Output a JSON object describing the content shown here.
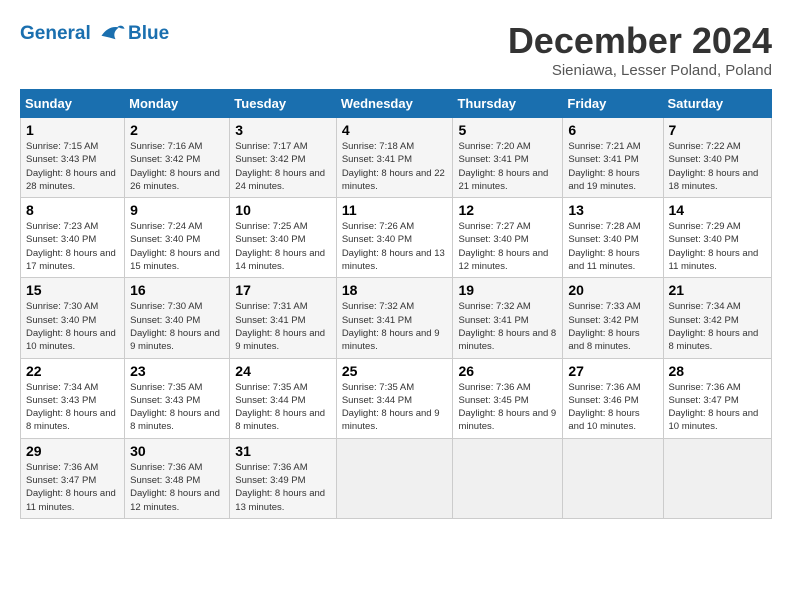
{
  "logo": {
    "line1": "General",
    "line2": "Blue"
  },
  "title": "December 2024",
  "subtitle": "Sieniawa, Lesser Poland, Poland",
  "days_header": [
    "Sunday",
    "Monday",
    "Tuesday",
    "Wednesday",
    "Thursday",
    "Friday",
    "Saturday"
  ],
  "weeks": [
    [
      {
        "day": "1",
        "sunrise": "Sunrise: 7:15 AM",
        "sunset": "Sunset: 3:43 PM",
        "daylight": "Daylight: 8 hours and 28 minutes."
      },
      {
        "day": "2",
        "sunrise": "Sunrise: 7:16 AM",
        "sunset": "Sunset: 3:42 PM",
        "daylight": "Daylight: 8 hours and 26 minutes."
      },
      {
        "day": "3",
        "sunrise": "Sunrise: 7:17 AM",
        "sunset": "Sunset: 3:42 PM",
        "daylight": "Daylight: 8 hours and 24 minutes."
      },
      {
        "day": "4",
        "sunrise": "Sunrise: 7:18 AM",
        "sunset": "Sunset: 3:41 PM",
        "daylight": "Daylight: 8 hours and 22 minutes."
      },
      {
        "day": "5",
        "sunrise": "Sunrise: 7:20 AM",
        "sunset": "Sunset: 3:41 PM",
        "daylight": "Daylight: 8 hours and 21 minutes."
      },
      {
        "day": "6",
        "sunrise": "Sunrise: 7:21 AM",
        "sunset": "Sunset: 3:41 PM",
        "daylight": "Daylight: 8 hours and 19 minutes."
      },
      {
        "day": "7",
        "sunrise": "Sunrise: 7:22 AM",
        "sunset": "Sunset: 3:40 PM",
        "daylight": "Daylight: 8 hours and 18 minutes."
      }
    ],
    [
      {
        "day": "8",
        "sunrise": "Sunrise: 7:23 AM",
        "sunset": "Sunset: 3:40 PM",
        "daylight": "Daylight: 8 hours and 17 minutes."
      },
      {
        "day": "9",
        "sunrise": "Sunrise: 7:24 AM",
        "sunset": "Sunset: 3:40 PM",
        "daylight": "Daylight: 8 hours and 15 minutes."
      },
      {
        "day": "10",
        "sunrise": "Sunrise: 7:25 AM",
        "sunset": "Sunset: 3:40 PM",
        "daylight": "Daylight: 8 hours and 14 minutes."
      },
      {
        "day": "11",
        "sunrise": "Sunrise: 7:26 AM",
        "sunset": "Sunset: 3:40 PM",
        "daylight": "Daylight: 8 hours and 13 minutes."
      },
      {
        "day": "12",
        "sunrise": "Sunrise: 7:27 AM",
        "sunset": "Sunset: 3:40 PM",
        "daylight": "Daylight: 8 hours and 12 minutes."
      },
      {
        "day": "13",
        "sunrise": "Sunrise: 7:28 AM",
        "sunset": "Sunset: 3:40 PM",
        "daylight": "Daylight: 8 hours and 11 minutes."
      },
      {
        "day": "14",
        "sunrise": "Sunrise: 7:29 AM",
        "sunset": "Sunset: 3:40 PM",
        "daylight": "Daylight: 8 hours and 11 minutes."
      }
    ],
    [
      {
        "day": "15",
        "sunrise": "Sunrise: 7:30 AM",
        "sunset": "Sunset: 3:40 PM",
        "daylight": "Daylight: 8 hours and 10 minutes."
      },
      {
        "day": "16",
        "sunrise": "Sunrise: 7:30 AM",
        "sunset": "Sunset: 3:40 PM",
        "daylight": "Daylight: 8 hours and 9 minutes."
      },
      {
        "day": "17",
        "sunrise": "Sunrise: 7:31 AM",
        "sunset": "Sunset: 3:41 PM",
        "daylight": "Daylight: 8 hours and 9 minutes."
      },
      {
        "day": "18",
        "sunrise": "Sunrise: 7:32 AM",
        "sunset": "Sunset: 3:41 PM",
        "daylight": "Daylight: 8 hours and 9 minutes."
      },
      {
        "day": "19",
        "sunrise": "Sunrise: 7:32 AM",
        "sunset": "Sunset: 3:41 PM",
        "daylight": "Daylight: 8 hours and 8 minutes."
      },
      {
        "day": "20",
        "sunrise": "Sunrise: 7:33 AM",
        "sunset": "Sunset: 3:42 PM",
        "daylight": "Daylight: 8 hours and 8 minutes."
      },
      {
        "day": "21",
        "sunrise": "Sunrise: 7:34 AM",
        "sunset": "Sunset: 3:42 PM",
        "daylight": "Daylight: 8 hours and 8 minutes."
      }
    ],
    [
      {
        "day": "22",
        "sunrise": "Sunrise: 7:34 AM",
        "sunset": "Sunset: 3:43 PM",
        "daylight": "Daylight: 8 hours and 8 minutes."
      },
      {
        "day": "23",
        "sunrise": "Sunrise: 7:35 AM",
        "sunset": "Sunset: 3:43 PM",
        "daylight": "Daylight: 8 hours and 8 minutes."
      },
      {
        "day": "24",
        "sunrise": "Sunrise: 7:35 AM",
        "sunset": "Sunset: 3:44 PM",
        "daylight": "Daylight: 8 hours and 8 minutes."
      },
      {
        "day": "25",
        "sunrise": "Sunrise: 7:35 AM",
        "sunset": "Sunset: 3:44 PM",
        "daylight": "Daylight: 8 hours and 9 minutes."
      },
      {
        "day": "26",
        "sunrise": "Sunrise: 7:36 AM",
        "sunset": "Sunset: 3:45 PM",
        "daylight": "Daylight: 8 hours and 9 minutes."
      },
      {
        "day": "27",
        "sunrise": "Sunrise: 7:36 AM",
        "sunset": "Sunset: 3:46 PM",
        "daylight": "Daylight: 8 hours and 10 minutes."
      },
      {
        "day": "28",
        "sunrise": "Sunrise: 7:36 AM",
        "sunset": "Sunset: 3:47 PM",
        "daylight": "Daylight: 8 hours and 10 minutes."
      }
    ],
    [
      {
        "day": "29",
        "sunrise": "Sunrise: 7:36 AM",
        "sunset": "Sunset: 3:47 PM",
        "daylight": "Daylight: 8 hours and 11 minutes."
      },
      {
        "day": "30",
        "sunrise": "Sunrise: 7:36 AM",
        "sunset": "Sunset: 3:48 PM",
        "daylight": "Daylight: 8 hours and 12 minutes."
      },
      {
        "day": "31",
        "sunrise": "Sunrise: 7:36 AM",
        "sunset": "Sunset: 3:49 PM",
        "daylight": "Daylight: 8 hours and 13 minutes."
      },
      null,
      null,
      null,
      null
    ]
  ]
}
